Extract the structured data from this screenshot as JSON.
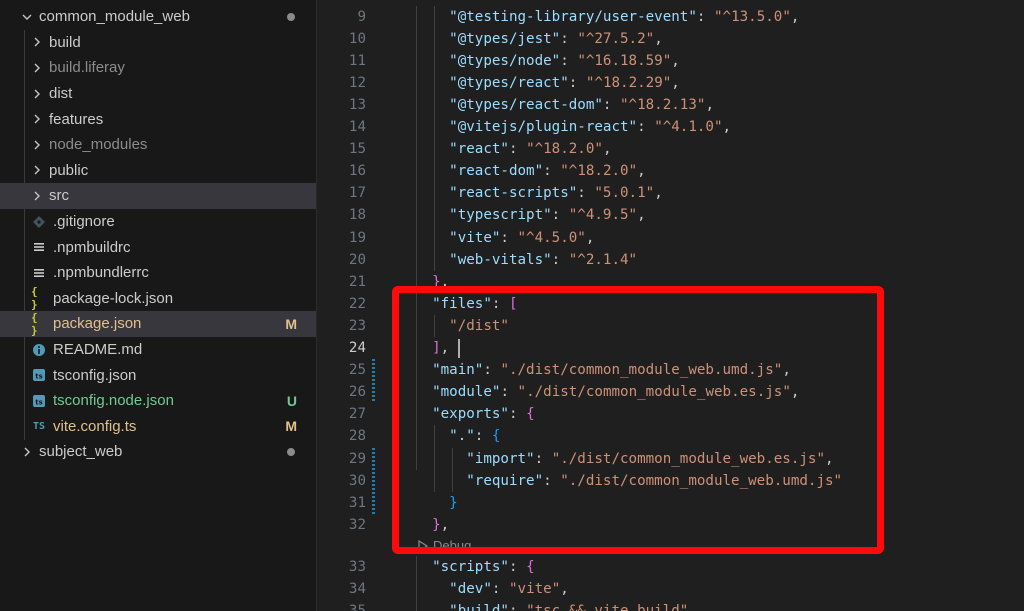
{
  "explorer": {
    "root": {
      "label": "common_module_web"
    },
    "items": [
      {
        "label": "build",
        "type": "folder",
        "color": "#cccccc"
      },
      {
        "label": "build.liferay",
        "type": "folder",
        "color": "#8c8c8c"
      },
      {
        "label": "dist",
        "type": "folder",
        "color": "#cccccc"
      },
      {
        "label": "features",
        "type": "folder",
        "color": "#cccccc"
      },
      {
        "label": "node_modules",
        "type": "folder",
        "color": "#8c8c8c"
      },
      {
        "label": "public",
        "type": "folder",
        "color": "#cccccc"
      },
      {
        "label": "src",
        "type": "folder",
        "color": "#cccccc"
      },
      {
        "label": ".gitignore",
        "type": "file",
        "icon": "gitignore-icon",
        "color": "#cccccc"
      },
      {
        "label": ".npmbuildrc",
        "type": "file",
        "icon": "config-icon",
        "color": "#cccccc"
      },
      {
        "label": ".npmbundlerrc",
        "type": "file",
        "icon": "config-icon",
        "color": "#cccccc"
      },
      {
        "label": "package-lock.json",
        "type": "file",
        "icon": "json-icon",
        "color": "#cccccc"
      },
      {
        "label": "package.json",
        "type": "file",
        "icon": "json-icon",
        "color": "#e2c08d",
        "status": "M"
      },
      {
        "label": "README.md",
        "type": "file",
        "icon": "info-icon",
        "color": "#cccccc"
      },
      {
        "label": "tsconfig.json",
        "type": "file",
        "icon": "ts-config-icon",
        "color": "#cccccc"
      },
      {
        "label": "tsconfig.node.json",
        "type": "file",
        "icon": "ts-config-icon",
        "color": "#73c991",
        "status": "U"
      },
      {
        "label": "vite.config.ts",
        "type": "file",
        "icon": "typescript-icon",
        "color": "#e2c08d",
        "status": "M"
      }
    ],
    "sibling": {
      "label": "subject_web"
    }
  },
  "icons": {
    "json": "{ }",
    "ts": "TS"
  },
  "status_colors": {
    "M": "#e2c08d",
    "U": "#73c991"
  },
  "editor": {
    "active_line": "24",
    "codelens": "Debug",
    "lines": [
      {
        "n": "9",
        "text": "    \"@testing-library/user-event\": \"^13.5.0\","
      },
      {
        "n": "10",
        "text": "    \"@types/jest\": \"^27.5.2\","
      },
      {
        "n": "11",
        "text": "    \"@types/node\": \"^16.18.59\","
      },
      {
        "n": "12",
        "text": "    \"@types/react\": \"^18.2.29\","
      },
      {
        "n": "13",
        "text": "    \"@types/react-dom\": \"^18.2.13\","
      },
      {
        "n": "14",
        "text": "    \"@vitejs/plugin-react\": \"^4.1.0\","
      },
      {
        "n": "15",
        "text": "    \"react\": \"^18.2.0\","
      },
      {
        "n": "16",
        "text": "    \"react-dom\": \"^18.2.0\","
      },
      {
        "n": "17",
        "text": "    \"react-scripts\": \"5.0.1\","
      },
      {
        "n": "18",
        "text": "    \"typescript\": \"^4.9.5\","
      },
      {
        "n": "19",
        "text": "    \"vite\": \"^4.5.0\","
      },
      {
        "n": "20",
        "text": "    \"web-vitals\": \"^2.1.4\""
      },
      {
        "n": "21",
        "text": "  },"
      },
      {
        "n": "22",
        "text": "  \"files\": ["
      },
      {
        "n": "23",
        "text": "    \"/dist\""
      },
      {
        "n": "24",
        "text": "  ],"
      },
      {
        "n": "25",
        "text": "  \"main\": \"./dist/common_module_web.umd.js\","
      },
      {
        "n": "26",
        "text": "  \"module\": \"./dist/common_module_web.es.js\","
      },
      {
        "n": "27",
        "text": "  \"exports\": {"
      },
      {
        "n": "28",
        "text": "    \".\": {"
      },
      {
        "n": "29",
        "text": "      \"import\": \"./dist/common_module_web.es.js\","
      },
      {
        "n": "30",
        "text": "      \"require\": \"./dist/common_module_web.umd.js\""
      },
      {
        "n": "31",
        "text": "    }"
      },
      {
        "n": "32",
        "text": "  },"
      },
      {
        "n": "33",
        "text": "  \"scripts\": {"
      },
      {
        "n": "34",
        "text": "    \"dev\": \"vite\","
      },
      {
        "n": "35",
        "text": "    \"build\": \"tsc && vite build\","
      }
    ]
  },
  "highlight_color": "#ff0a0a"
}
